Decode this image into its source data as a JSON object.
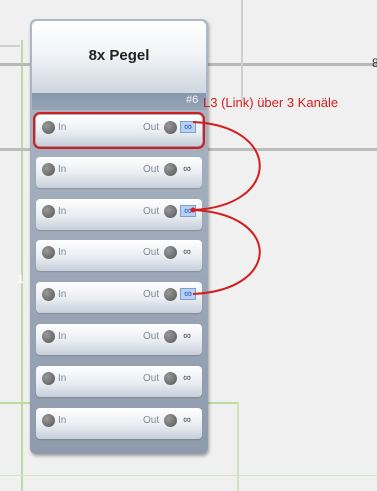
{
  "block": {
    "title": "8x Pegel",
    "number": "#6",
    "channels": [
      {
        "in_label": "In",
        "out_label": "Out",
        "selected": true,
        "linked": true
      },
      {
        "in_label": "In",
        "out_label": "Out",
        "selected": false,
        "linked": false
      },
      {
        "in_label": "In",
        "out_label": "Out",
        "selected": false,
        "linked": true
      },
      {
        "in_label": "In",
        "out_label": "Out",
        "selected": false,
        "linked": false
      },
      {
        "in_label": "In",
        "out_label": "Out",
        "selected": false,
        "linked": true
      },
      {
        "in_label": "In",
        "out_label": "Out",
        "selected": false,
        "linked": false
      },
      {
        "in_label": "In",
        "out_label": "Out",
        "selected": false,
        "linked": false
      },
      {
        "in_label": "In",
        "out_label": "Out",
        "selected": false,
        "linked": false
      }
    ],
    "link_icon": "link-chain-icon"
  },
  "annotation": {
    "text": "L3 (Link) über 3 Kanäle",
    "color": "#d21e1e"
  },
  "left_marker": "1",
  "edge_marker": "8"
}
